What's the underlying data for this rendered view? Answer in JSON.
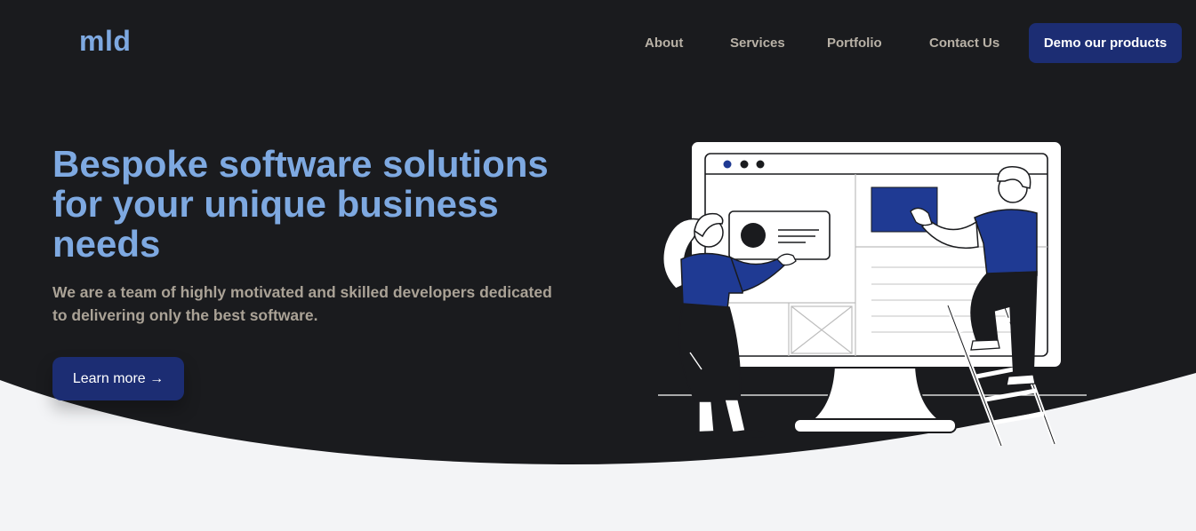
{
  "brand": {
    "logo_text": "mld"
  },
  "nav": {
    "links": [
      "About",
      "Services",
      "Portfolio",
      "Contact Us"
    ],
    "cta_label": "Demo our products"
  },
  "hero": {
    "headline": "Bespoke software solutions for your unique business needs",
    "subtext": "We are a team of highly motivated and skilled developers dedicated to delivering only the best software.",
    "cta_label": "Learn more →"
  },
  "colors": {
    "hero_background": "#1a1b1e",
    "page_background": "#f3f4f6",
    "accent_light_blue": "#7ea9e1",
    "primary_button": "#1c2d73",
    "illustration_blue": "#1f3a93",
    "nav_text": "#b8b1a6"
  },
  "icons": {
    "cta_arrow": "arrow-right-icon",
    "illustration": "developers-building-website-illustration"
  }
}
